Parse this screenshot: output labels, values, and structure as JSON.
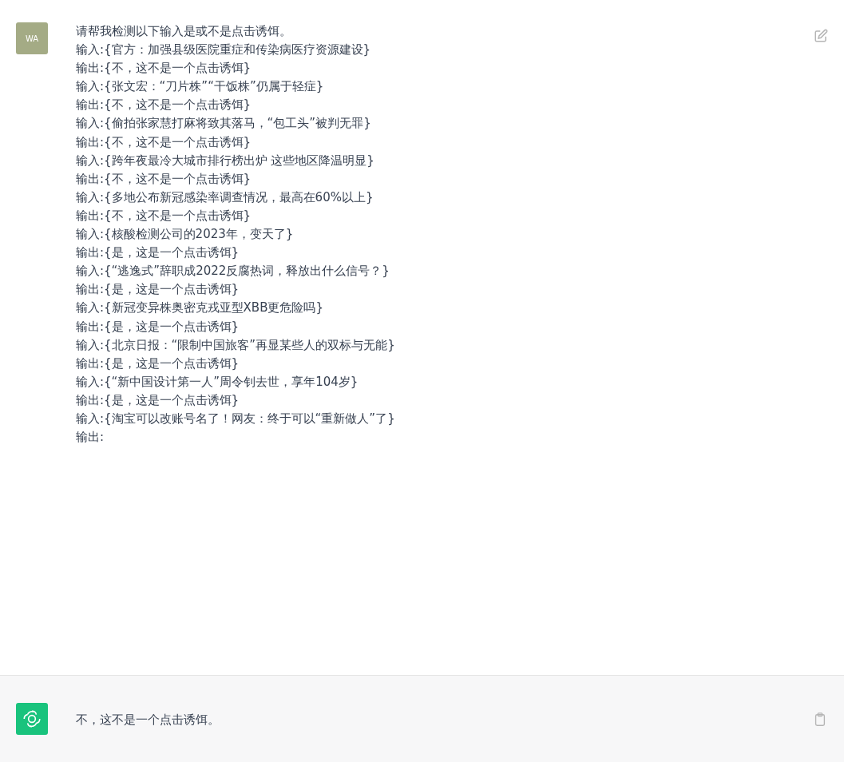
{
  "user_message": {
    "avatar": "WA",
    "lines": [
      "请帮我检测以下输入是或不是点击诱饵。",
      "输入:{官方：加强县级医院重症和传染病医疗资源建设}",
      "输出:{不，这不是一个点击诱饵}",
      "输入:{张文宏：“刀片株”“干饭株”仍属于轻症}",
      "输出:{不，这不是一个点击诱饵}",
      "输入:{偷拍张家慧打麻将致其落马，“包工头”被判无罪}",
      "输出:{不，这不是一个点击诱饵}",
      "输入:{跨年夜最冷大城市排行榜出炉 这些地区降温明显}",
      "输出:{不，这不是一个点击诱饵}",
      "输入:{多地公布新冠感染率调查情况，最高在60%以上}",
      "输出:{不，这不是一个点击诱饵}",
      "输入:{核酸检测公司的2023年，变天了}",
      "输出:{是，这是一个点击诱饵}",
      "输入:{“逃逸式”辞职成2022反腐热词，释放出什么信号？}",
      "输出:{是，这是一个点击诱饵}",
      "输入:{新冠变异株奥密克戎亚型XBB更危险吗}",
      "输出:{是，这是一个点击诱饵}",
      "输入:{北京日报：“限制中国旅客”再显某些人的双标与无能}",
      "输出:{是，这是一个点击诱饵}",
      "输入:{“新中国设计第一人”周令钊去世，享年104岁}",
      "输出:{是，这是一个点击诱饵}",
      "输入:{淘宝可以改账号名了！网友：终于可以“重新做人”了}",
      "输出:"
    ]
  },
  "assistant_message": {
    "text": "不，这不是一个点击诱饵。"
  }
}
